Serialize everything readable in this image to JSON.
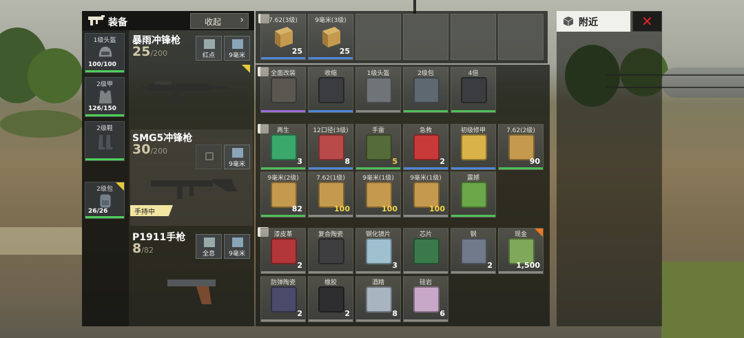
{
  "equipment": {
    "title": "装备",
    "collapse_label": "收起",
    "armor": [
      {
        "name": "1级头盔",
        "durability": "100/100",
        "icon": "helmet-icon"
      },
      {
        "name": "2级甲",
        "durability": "126/150",
        "icon": "vest-icon"
      },
      {
        "name": "2级鞋",
        "durability": "",
        "icon": "boots-icon"
      },
      {
        "name": "2级包",
        "durability": "26/26",
        "icon": "backpack-icon"
      }
    ],
    "weapons": [
      {
        "name": "暴雨冲锋枪",
        "ammo": "25",
        "max": "200",
        "attachments": [
          "红点",
          "9毫米"
        ],
        "held": ""
      },
      {
        "name": "SMG5冲锋枪",
        "ammo": "30",
        "max": "200",
        "attachments": [
          "",
          "9毫米"
        ],
        "held": "手持中"
      },
      {
        "name": "P1911手枪",
        "ammo": "8",
        "max": "82",
        "attachments": [
          "全息",
          "9毫米"
        ],
        "held": ""
      }
    ]
  },
  "ground_top": [
    {
      "name": "7.62(3级)",
      "count": "25",
      "icon": "ammo-box-icon"
    },
    {
      "name": "9毫米(3级)",
      "count": "25",
      "icon": "ammo-box-icon"
    }
  ],
  "ground": {
    "attachments": [
      {
        "name": "全面改装",
        "count": "",
        "icon": "mod-kit-icon"
      },
      {
        "name": "收缩",
        "count": "",
        "icon": "suppressor-icon"
      },
      {
        "name": "1级头盔",
        "count": "",
        "icon": "helmet-icon"
      },
      {
        "name": "2级包",
        "count": "",
        "icon": "backpack-icon"
      },
      {
        "name": "4倍",
        "count": "",
        "icon": "scope-icon"
      }
    ],
    "consumables": [
      {
        "name": "再生",
        "count": "3",
        "icon": "regen-icon"
      },
      {
        "name": "12口径(3级)",
        "count": "8",
        "icon": "shotgun-ammo-icon"
      },
      {
        "name": "手雷",
        "count": "5",
        "icon": "grenade-icon"
      },
      {
        "name": "急救",
        "count": "2",
        "icon": "first-aid-icon"
      },
      {
        "name": "初级修甲",
        "count": "",
        "icon": "armor-repair-icon"
      },
      {
        "name": "7.62(2级)",
        "count": "90",
        "icon": "ammo-box-icon"
      },
      {
        "name": "9毫米(2级)",
        "count": "82",
        "icon": "ammo-box-icon"
      },
      {
        "name": "7.62(1级)",
        "count": "100",
        "icon": "ammo-box-icon"
      },
      {
        "name": "9毫米(1级)",
        "count": "100",
        "icon": "ammo-box-icon"
      },
      {
        "name": "9毫米(1级)",
        "count": "100",
        "icon": "ammo-box-icon"
      },
      {
        "name": "震撼",
        "count": "",
        "icon": "stun-grenade-icon"
      }
    ],
    "materials": [
      {
        "name": "漆皮革",
        "count": "2",
        "icon": "leather-icon"
      },
      {
        "name": "复合陶瓷",
        "count": "",
        "icon": "ceramic-icon"
      },
      {
        "name": "钢化镜片",
        "count": "3",
        "icon": "lens-icon"
      },
      {
        "name": "芯片",
        "count": "",
        "icon": "chip-icon"
      },
      {
        "name": "钢",
        "count": "2",
        "icon": "steel-icon"
      },
      {
        "name": "现金",
        "count": "1,500",
        "icon": "cash-icon"
      },
      {
        "name": "防弹陶瓷",
        "count": "2",
        "icon": "ceramic-plate-icon"
      },
      {
        "name": "橡胶",
        "count": "2",
        "icon": "rubber-icon"
      },
      {
        "name": "酒精",
        "count": "8",
        "icon": "alcohol-icon"
      },
      {
        "name": "硅岩",
        "count": "6",
        "icon": "silicon-rock-icon"
      }
    ]
  },
  "nearby": {
    "title": "附近",
    "close_icon": "close-icon"
  },
  "colors": {
    "purple": "#9b6fd6",
    "blue": "#4f86d6",
    "green": "#4fbf59",
    "gray": "#8a8a84",
    "gold": "#f3d64a",
    "close": "#e3262a"
  }
}
